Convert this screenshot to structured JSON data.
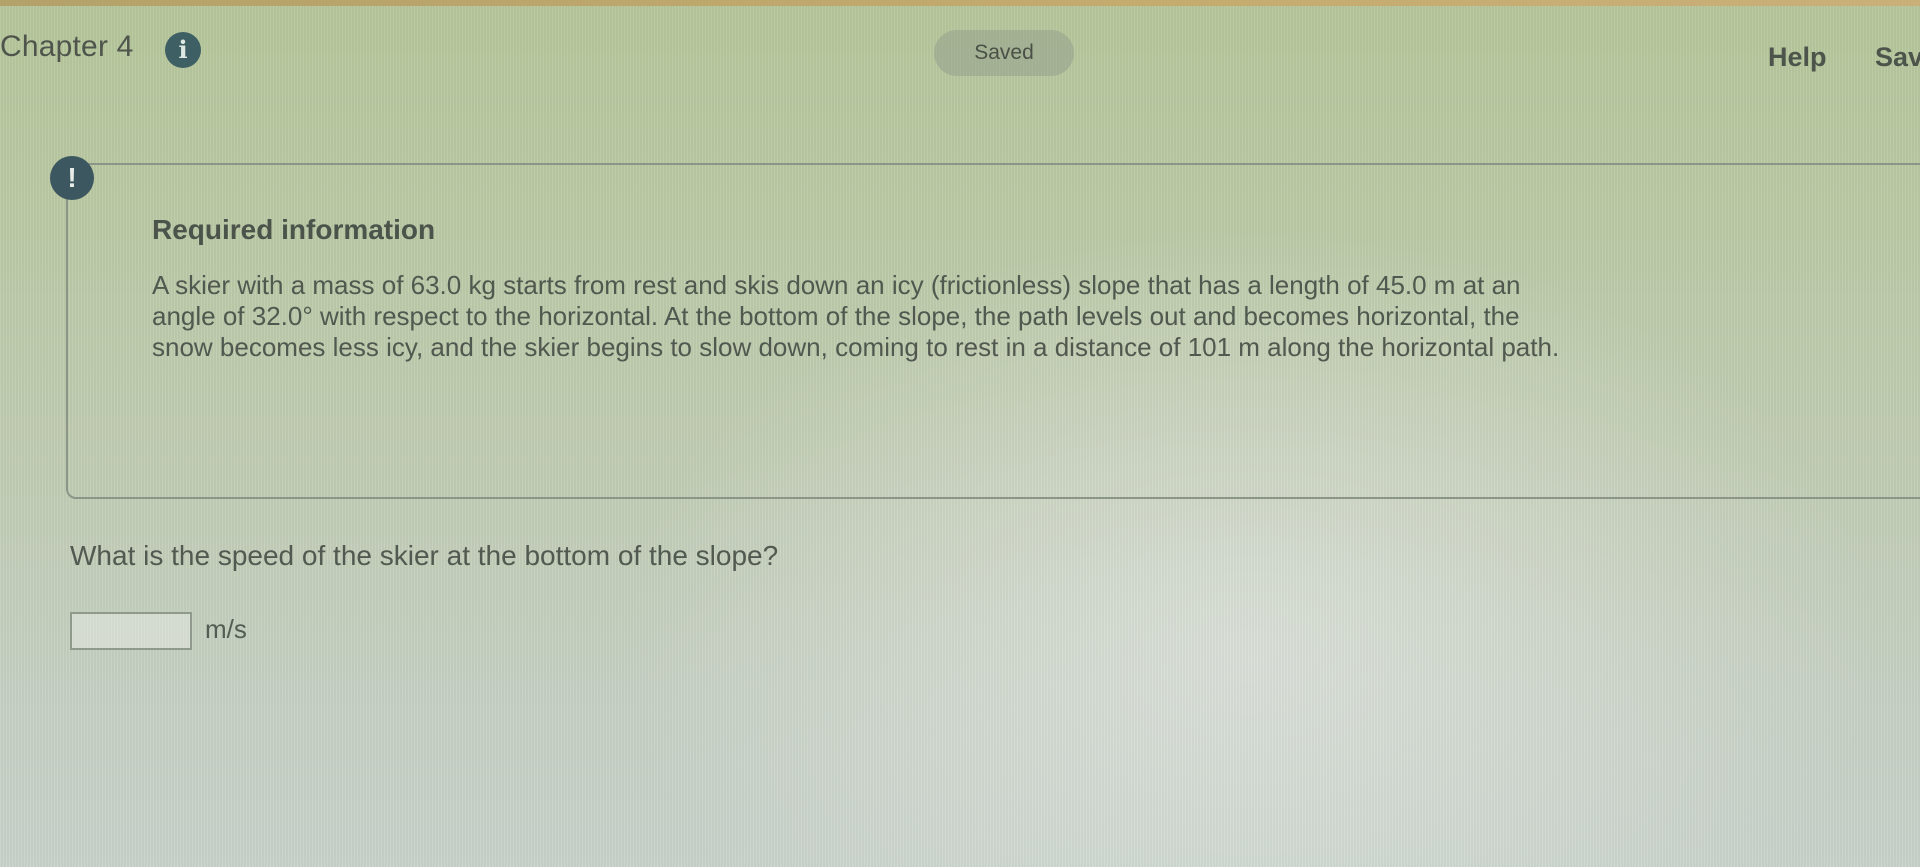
{
  "header": {
    "chapter_title": "Chapter 4",
    "info_icon_glyph": "i",
    "status": "Saved",
    "help_label": "Help",
    "save_label": "Save"
  },
  "card": {
    "alert_glyph": "!",
    "title": "Required information",
    "body_lines": [
      "A skier with a mass of 63.0 kg starts from rest and skis down an icy (frictionless) slope that has a length of 45.0 m at an",
      "angle of 32.0° with respect to the horizontal. At the bottom of the slope, the path levels out and becomes horizontal, the",
      "snow becomes less icy, and the skier begins to slow down, coming to rest in a distance of 101 m along the horizontal path."
    ]
  },
  "question": {
    "text": "What is the speed of the skier at the bottom of the slope?",
    "answer_value": "",
    "unit": "m/s"
  },
  "icons": {
    "info": "info-icon",
    "alert": "exclamation-icon"
  },
  "colors": {
    "info_badge": "#3e5f63",
    "alert_badge": "#3c5760",
    "saved_pill": "#9aa38d"
  }
}
